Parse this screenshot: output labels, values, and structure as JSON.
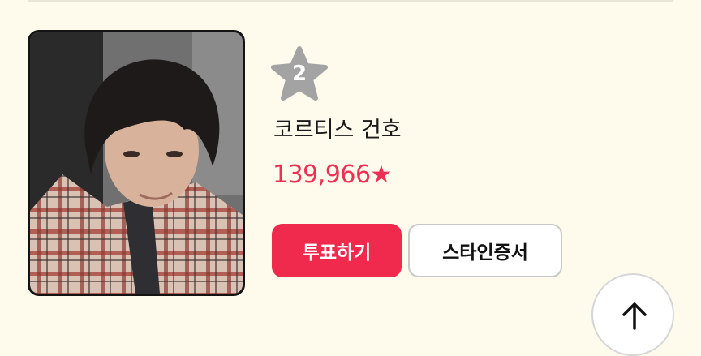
{
  "rank": {
    "number": "2",
    "badge_icon": "star-icon",
    "badge_color": "#a3a3a3"
  },
  "artist": {
    "name": "코르티스 건호",
    "votes": "139,966★",
    "votes_color": "#ee2e52"
  },
  "actions": {
    "vote_label": "투표하기",
    "certificate_label": "스타인증서",
    "vote_color": "#f02a4d"
  },
  "scroll_top": {
    "icon": "arrow-up-icon"
  },
  "background_color": "#fefbec"
}
